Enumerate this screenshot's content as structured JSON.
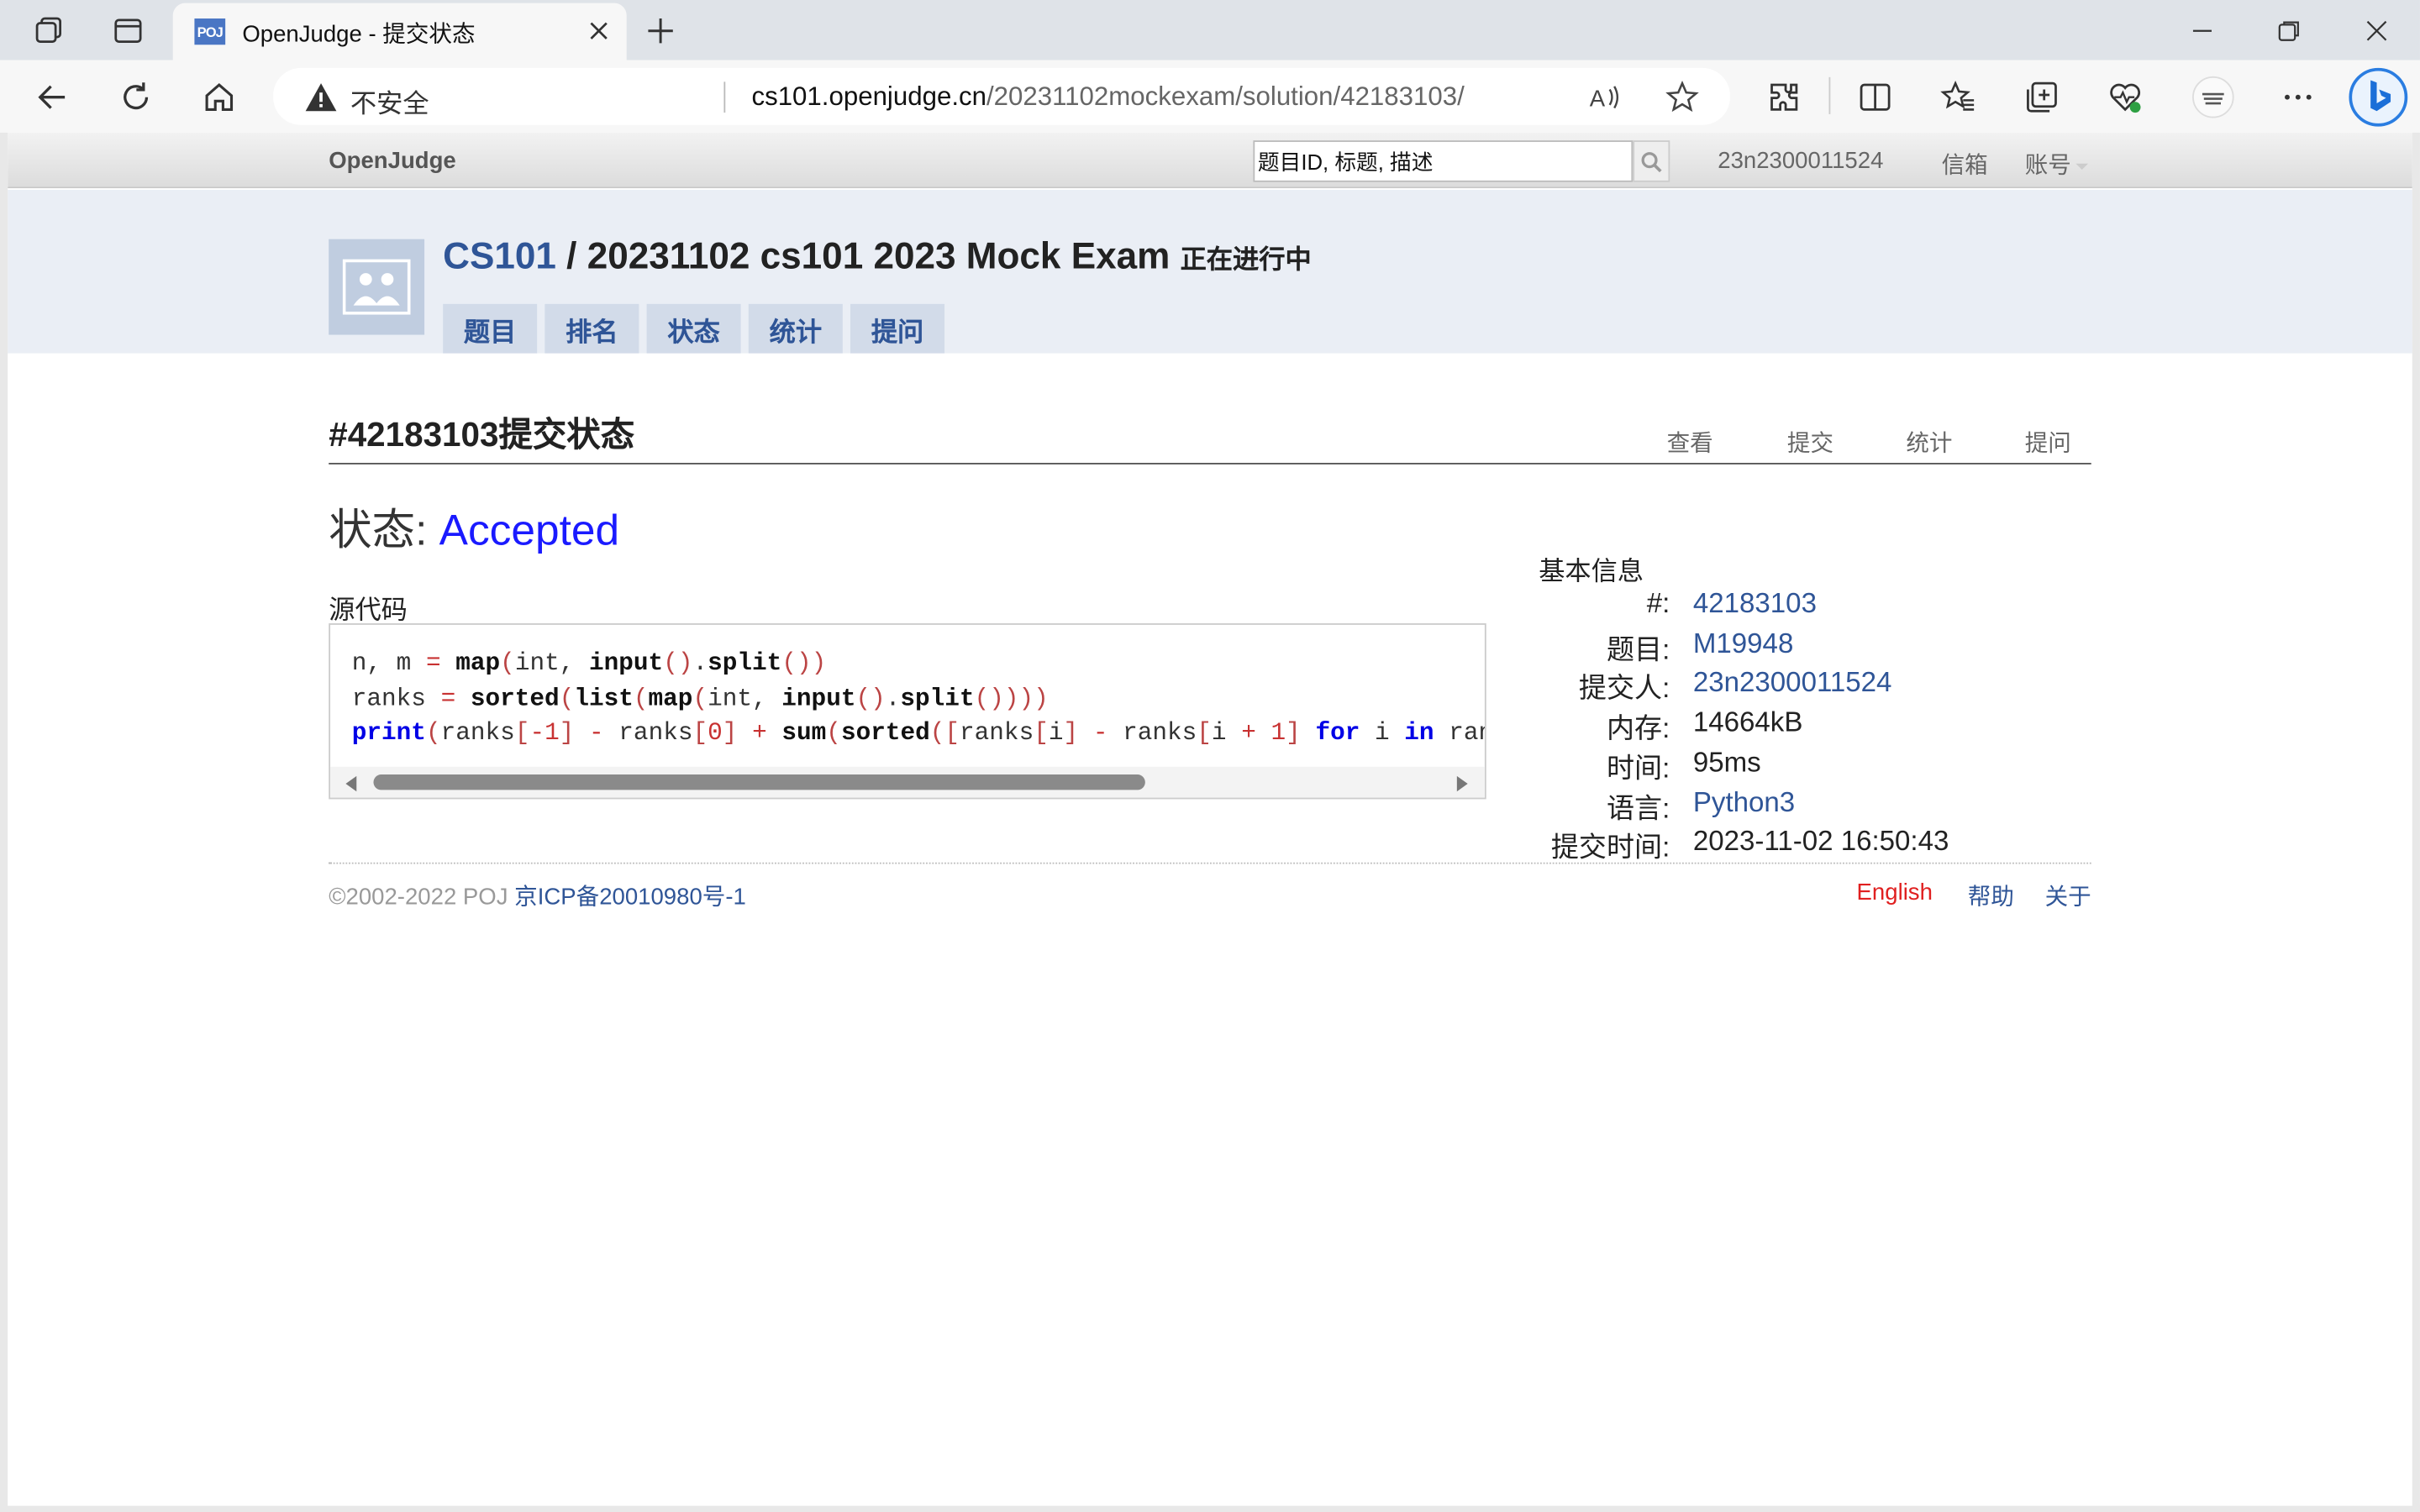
{
  "browser": {
    "tab_title": "OpenJudge - 提交状态",
    "favicon_text": "POJ",
    "insecure_label": "不安全",
    "url_host": "cs101.openjudge.cn",
    "url_path": "/20231102mockexam/solution/42183103/"
  },
  "topbar": {
    "brand": "OpenJudge",
    "search_value": "题目ID, 标题, 描述",
    "username": "23n2300011524",
    "mailbox": "信箱",
    "account": "账号"
  },
  "contest": {
    "course": "CS101",
    "separator": " / ",
    "name": "20231102 cs101 2023 Mock Exam",
    "state": "正在进行中",
    "tabs": [
      "题目",
      "排名",
      "状态",
      "统计",
      "提问"
    ]
  },
  "solution": {
    "heading": "#42183103提交状态",
    "links": [
      "查看",
      "提交",
      "统计",
      "提问"
    ],
    "status_label": "状态: ",
    "status_value": "Accepted",
    "source_label": "源代码"
  },
  "info": {
    "title": "基本信息",
    "rows": [
      {
        "key": "#:",
        "value": "42183103"
      },
      {
        "key": "题目:",
        "value": "M19948"
      },
      {
        "key": "提交人:",
        "value": "23n2300011524"
      },
      {
        "key": "内存:",
        "value": "14664kB"
      },
      {
        "key": "时间:",
        "value": "95ms"
      },
      {
        "key": "语言:",
        "value": "Python3"
      },
      {
        "key": "提交时间:",
        "value": "2023-11-02 16:50:43"
      }
    ]
  },
  "footer": {
    "copyright": "©2002-2022 POJ ",
    "icp": "京ICP备20010980号-1",
    "english": "English",
    "help": "帮助",
    "about": "关于"
  },
  "colors": {
    "link": "#2f5597",
    "accepted": "#1a1aff",
    "english": "#e02020",
    "header_band": "#eaeef5"
  }
}
